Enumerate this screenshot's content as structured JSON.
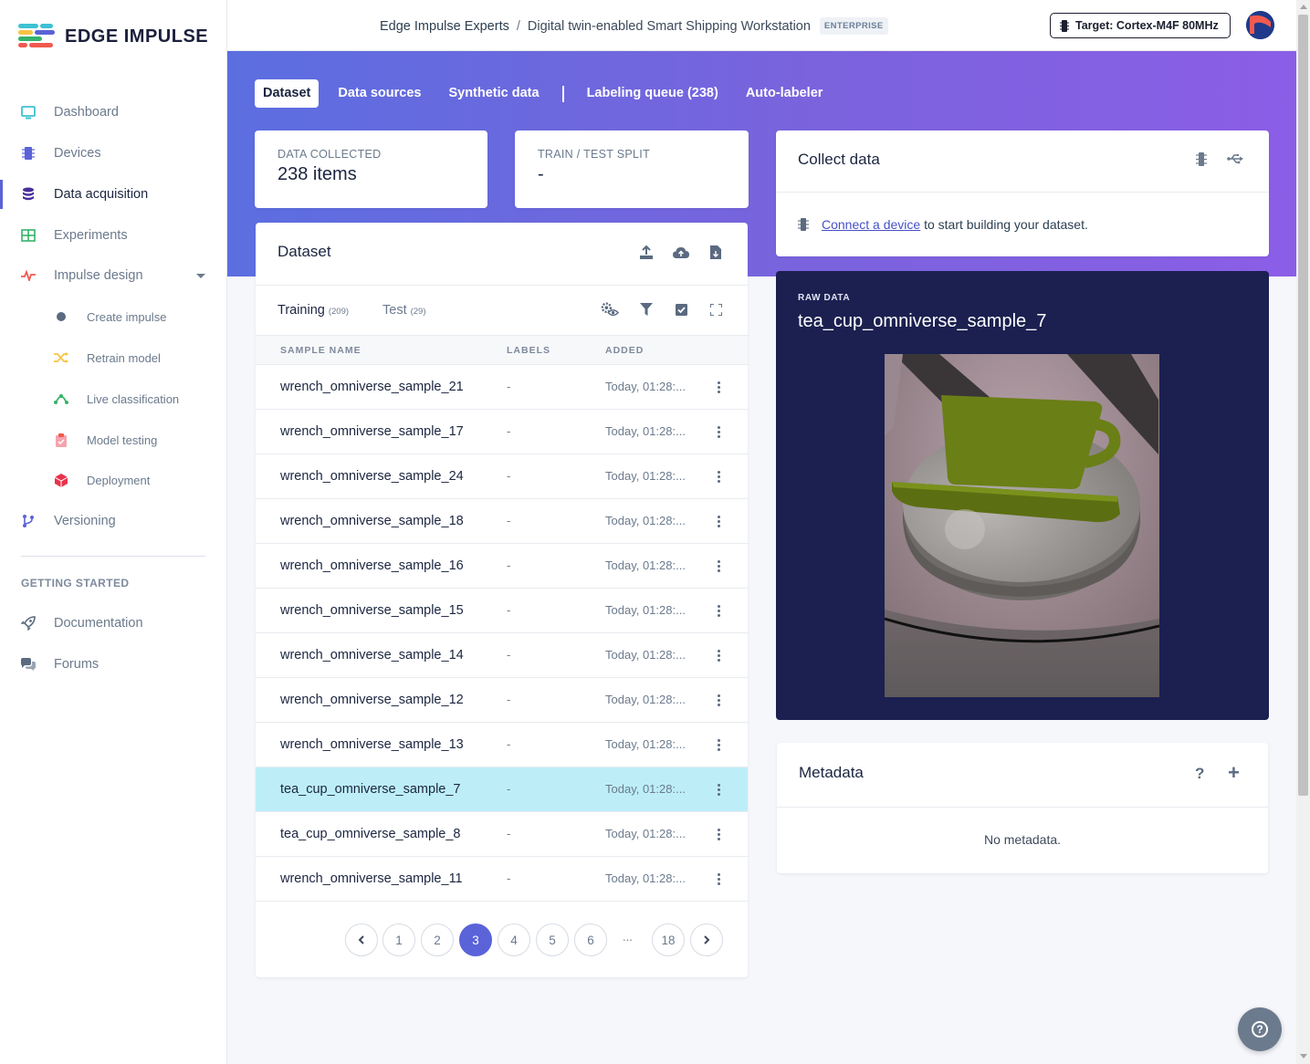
{
  "brand": {
    "name": "EDGE IMPULSE"
  },
  "sidebar": {
    "items": [
      {
        "label": "Dashboard",
        "icon": "monitor-icon"
      },
      {
        "label": "Devices",
        "icon": "chip-icon"
      },
      {
        "label": "Data acquisition",
        "icon": "database-icon",
        "active": true
      },
      {
        "label": "Experiments",
        "icon": "grid-icon"
      },
      {
        "label": "Impulse design",
        "icon": "pulse-icon"
      },
      {
        "label": "Create impulse",
        "icon": "dot-icon"
      },
      {
        "label": "Retrain model",
        "icon": "shuffle-icon"
      },
      {
        "label": "Live classification",
        "icon": "live-icon"
      },
      {
        "label": "Model testing",
        "icon": "clipboard-icon"
      },
      {
        "label": "Deployment",
        "icon": "cube-icon"
      },
      {
        "label": "Versioning",
        "icon": "branch-icon"
      }
    ],
    "section_title": "GETTING STARTED",
    "getting_started": [
      {
        "label": "Documentation",
        "icon": "rocket-icon"
      },
      {
        "label": "Forums",
        "icon": "chat-icon"
      }
    ]
  },
  "topbar": {
    "org": "Edge Impulse Experts",
    "separator": "/",
    "project": "Digital twin-enabled Smart Shipping Workstation",
    "badge": "ENTERPRISE",
    "target": "Target: Cortex-M4F 80MHz"
  },
  "tabs": {
    "dataset": "Dataset",
    "data_sources": "Data sources",
    "synthetic": "Synthetic data",
    "labeling_queue": "Labeling queue (238)",
    "auto_labeler": "Auto-labeler"
  },
  "stats": {
    "collected_label": "DATA COLLECTED",
    "collected_value": "238 items",
    "split_label": "TRAIN / TEST SPLIT",
    "split_value": "-"
  },
  "dataset": {
    "title": "Dataset",
    "training_label": "Training",
    "training_count": "(209)",
    "test_label": "Test",
    "test_count": "(29)",
    "columns": [
      "SAMPLE NAME",
      "LABELS",
      "ADDED"
    ],
    "rows": [
      {
        "name": "wrench_omniverse_sample_21",
        "label": "-",
        "added": "Today, 01:28:..."
      },
      {
        "name": "wrench_omniverse_sample_17",
        "label": "-",
        "added": "Today, 01:28:..."
      },
      {
        "name": "wrench_omniverse_sample_24",
        "label": "-",
        "added": "Today, 01:28:..."
      },
      {
        "name": "wrench_omniverse_sample_18",
        "label": "-",
        "added": "Today, 01:28:..."
      },
      {
        "name": "wrench_omniverse_sample_16",
        "label": "-",
        "added": "Today, 01:28:..."
      },
      {
        "name": "wrench_omniverse_sample_15",
        "label": "-",
        "added": "Today, 01:28:..."
      },
      {
        "name": "wrench_omniverse_sample_14",
        "label": "-",
        "added": "Today, 01:28:..."
      },
      {
        "name": "wrench_omniverse_sample_12",
        "label": "-",
        "added": "Today, 01:28:..."
      },
      {
        "name": "wrench_omniverse_sample_13",
        "label": "-",
        "added": "Today, 01:28:..."
      },
      {
        "name": "tea_cup_omniverse_sample_7",
        "label": "-",
        "added": "Today, 01:28:...",
        "selected": true
      },
      {
        "name": "tea_cup_omniverse_sample_8",
        "label": "-",
        "added": "Today, 01:28:..."
      },
      {
        "name": "wrench_omniverse_sample_11",
        "label": "-",
        "added": "Today, 01:28:..."
      }
    ],
    "pagination": {
      "pages": [
        "1",
        "2",
        "3",
        "4",
        "5",
        "6"
      ],
      "ellipsis": "...",
      "last": "18",
      "current": "3"
    }
  },
  "collect": {
    "title": "Collect data",
    "link_text": "Connect a device",
    "text": " to start building your dataset."
  },
  "raw": {
    "label": "RAW DATA",
    "title": "tea_cup_omniverse_sample_7"
  },
  "metadata": {
    "title": "Metadata",
    "help": "?",
    "add": "+",
    "empty": "No metadata."
  },
  "colors": {
    "accent": "#5a63d8",
    "selected_row": "#bdeef8",
    "raw_bg": "#1b2050"
  }
}
